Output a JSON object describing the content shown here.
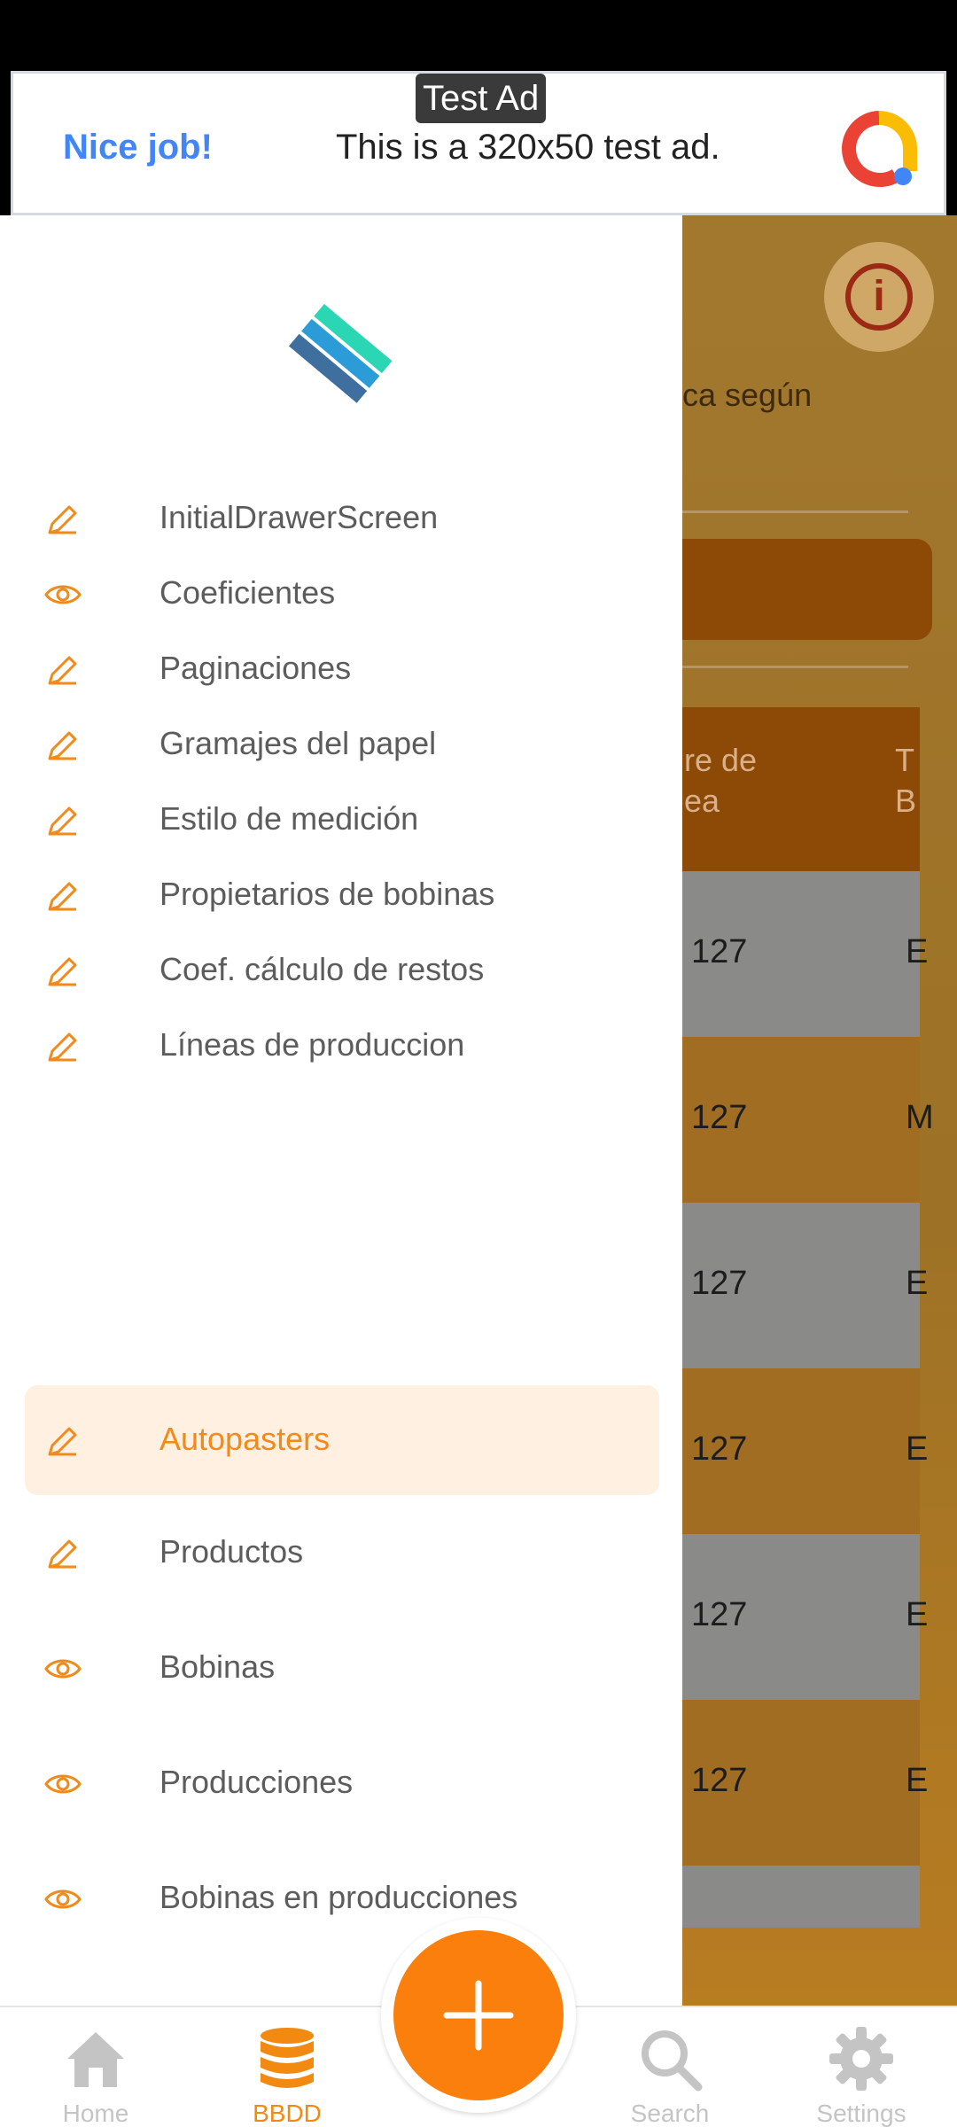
{
  "ad": {
    "tag": "Test Ad",
    "headline": "Nice job!",
    "body": "This is a 320x50 test ad."
  },
  "background": {
    "description_fragment": "ca según",
    "table_header_fragment_1": "re de\nea",
    "table_header_fragment_2": "T\nB",
    "rows": [
      {
        "value": "127",
        "cut": "E"
      },
      {
        "value": "127",
        "cut": "M"
      },
      {
        "value": "127",
        "cut": "E"
      },
      {
        "value": "127",
        "cut": "E"
      },
      {
        "value": "127",
        "cut": "E"
      },
      {
        "value": "127",
        "cut": "E"
      }
    ]
  },
  "drawer": {
    "items": [
      {
        "label": "InitialDrawerScreen",
        "icon": "pencil-icon"
      },
      {
        "label": "Coeficientes",
        "icon": "eye-icon"
      },
      {
        "label": "Paginaciones",
        "icon": "pencil-icon"
      },
      {
        "label": "Gramajes del papel",
        "icon": "pencil-icon"
      },
      {
        "label": "Estilo de medición",
        "icon": "pencil-icon"
      },
      {
        "label": "Propietarios de bobinas",
        "icon": "pencil-icon"
      },
      {
        "label": "Coef. cálculo de restos",
        "icon": "pencil-icon"
      },
      {
        "label": "Líneas de produccion",
        "icon": "pencil-icon"
      },
      {
        "label": "Autopasters",
        "icon": "pencil-icon",
        "active": true
      },
      {
        "label": "Productos",
        "icon": "pencil-icon"
      },
      {
        "label": "Bobinas",
        "icon": "eye-icon"
      },
      {
        "label": "Producciones",
        "icon": "eye-icon"
      },
      {
        "label": "Bobinas en producciones",
        "icon": "eye-icon"
      }
    ]
  },
  "bottom_nav": {
    "home": "Home",
    "bbdd": "BBDD",
    "search": "Search",
    "settings": "Settings"
  },
  "colors": {
    "accent": "#fb7f0c",
    "active_item_bg": "#fff0e2",
    "icon": "#f08a1a"
  }
}
